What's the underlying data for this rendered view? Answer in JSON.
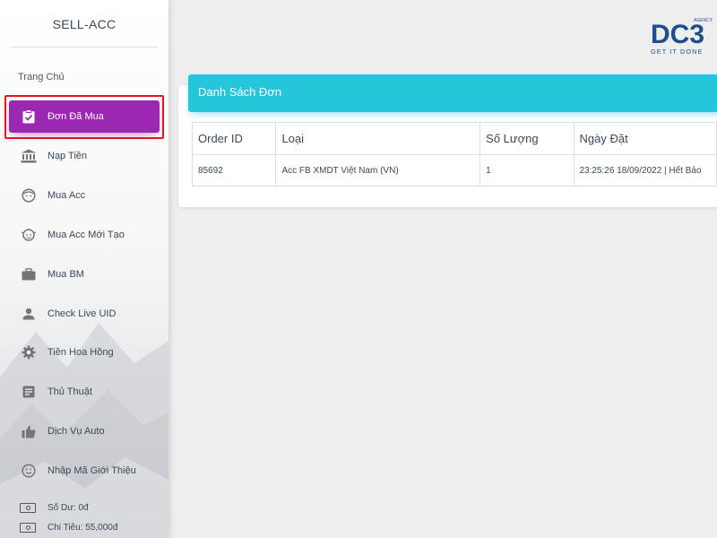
{
  "sidebar": {
    "brand": "SELL-ACC",
    "home": "Trang Chủ",
    "items": [
      {
        "label": "Đơn Đã Mua",
        "icon": "clipboard-check-icon",
        "active": true
      },
      {
        "label": "Nạp Tiền",
        "icon": "bank-icon"
      },
      {
        "label": "Mua Acc",
        "icon": "face-icon"
      },
      {
        "label": "Mua Acc Mới Tạo",
        "icon": "face-new-icon"
      },
      {
        "label": "Mua BM",
        "icon": "briefcase-icon"
      },
      {
        "label": "Check Live UID",
        "icon": "person-icon"
      },
      {
        "label": "Tiền Hoa Hồng",
        "icon": "gear-icon"
      },
      {
        "label": "Thủ Thuật",
        "icon": "article-icon"
      },
      {
        "label": "Dịch Vụ Auto",
        "icon": "thumb-up-icon"
      },
      {
        "label": "Nhập Mã Giới Thiệu",
        "icon": "smiley-icon"
      }
    ],
    "balance": "Số Dư: 0đ",
    "spent": "Chi Tiêu: 55,000đ"
  },
  "logo": {
    "text": "DC3",
    "tagline": "GET IT DONE",
    "superscript": "AGENCY"
  },
  "orders": {
    "title": "Danh Sách Đơn",
    "columns": [
      "Order ID",
      "Loại",
      "Số Lượng",
      "Ngày Đặt"
    ],
    "rows": [
      [
        "85692",
        "Acc FB XMDT Việt Nam (VN)",
        "1",
        "23:25:26 18/09/2022 | Hết Bảo"
      ]
    ]
  },
  "colors": {
    "active": "#9c27b0",
    "header": "#26c6da",
    "highlight": "#e3151a",
    "logo": "#1f4e8f"
  }
}
